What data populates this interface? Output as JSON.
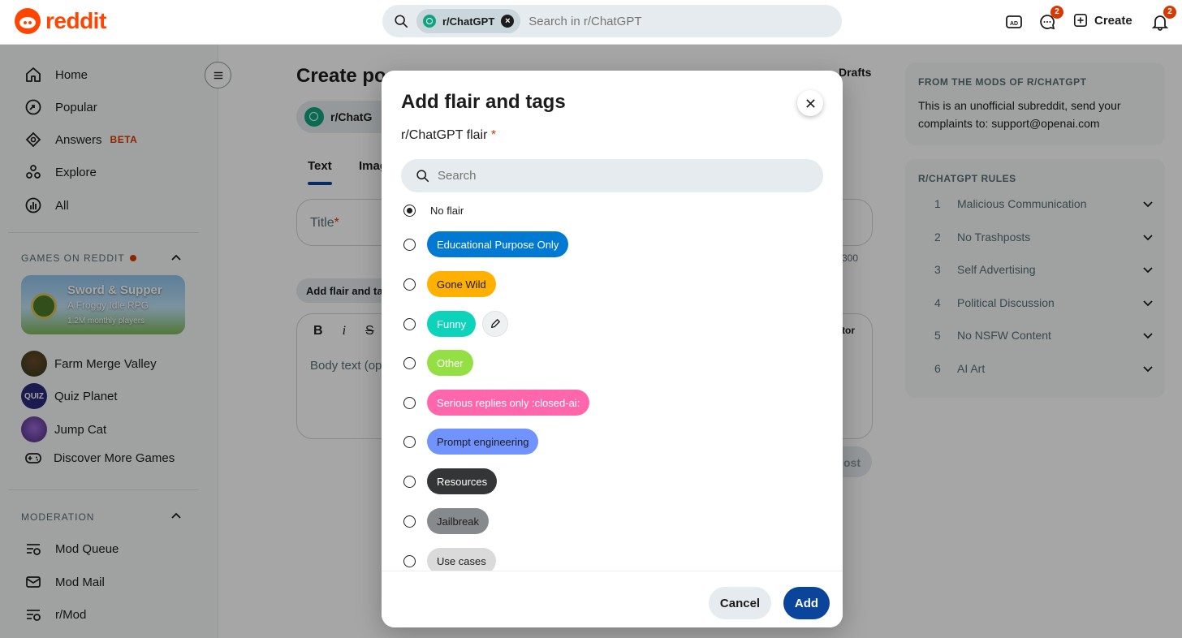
{
  "header": {
    "logo_text": "reddit",
    "search_chip": "r/ChatGPT",
    "search_placeholder": "Search in r/ChatGPT",
    "chat_badge": "2",
    "create_label": "Create",
    "notif_badge": "2"
  },
  "sidebar": {
    "nav": [
      {
        "label": "Home",
        "icon": "home-icon"
      },
      {
        "label": "Popular",
        "icon": "popular-icon"
      },
      {
        "label": "Answers",
        "icon": "answers-icon",
        "badge": "BETA"
      },
      {
        "label": "Explore",
        "icon": "explore-icon"
      },
      {
        "label": "All",
        "icon": "all-icon"
      }
    ],
    "games_section": "GAMES ON REDDIT",
    "featured_game": {
      "title": "Sword & Supper",
      "subtitle": "A Froggy Idle RPG",
      "players": "1.2M monthly players"
    },
    "games": [
      "Farm Merge Valley",
      "Quiz Planet",
      "Jump Cat",
      "Discover More Games"
    ],
    "moderation_section": "MODERATION",
    "mod_items": [
      "Mod Queue",
      "Mod Mail",
      "r/Mod"
    ]
  },
  "main": {
    "title": "Create po",
    "drafts": "Drafts",
    "subreddit": "r/ChatG",
    "tabs": [
      "Text",
      "Imag"
    ],
    "title_placeholder": "Title",
    "char_count": "300",
    "add_flair": "Add flair and ta",
    "body_placeholder": "Body text (op",
    "editor_link": "tor",
    "post_btn": "ost"
  },
  "right": {
    "mods_title": "FROM THE MODS OF R/CHATGPT",
    "mods_text": "This is an unofficial subreddit, send your complaints to: support@openai.com",
    "rules_title": "R/CHATGPT RULES",
    "rules": [
      {
        "num": "1",
        "text": "Malicious Communication"
      },
      {
        "num": "2",
        "text": "No Trashposts"
      },
      {
        "num": "3",
        "text": "Self Advertising"
      },
      {
        "num": "4",
        "text": "Political Discussion"
      },
      {
        "num": "5",
        "text": "No NSFW Content"
      },
      {
        "num": "6",
        "text": "AI Art"
      }
    ]
  },
  "modal": {
    "title": "Add flair and tags",
    "flair_label": "r/ChatGPT flair",
    "required_mark": "*",
    "search_placeholder": "Search",
    "no_flair": "No flair",
    "flairs": [
      {
        "label": "Educational Purpose Only",
        "bg": "#0079d3",
        "fg": "#ffffff"
      },
      {
        "label": "Gone Wild",
        "bg": "#ffb000",
        "fg": "#1c1c1c"
      },
      {
        "label": "Funny",
        "bg": "#0dd3bb",
        "fg": "#ffffff"
      },
      {
        "label": "Other",
        "bg": "#94e044",
        "fg": "#ffffff"
      },
      {
        "label": "Serious replies only :closed-ai:",
        "bg": "#ff66ac",
        "fg": "#ffffff"
      },
      {
        "label": "Prompt engineering",
        "bg": "#7193ff",
        "fg": "#1c1c1c"
      },
      {
        "label": "Resources",
        "bg": "#343536",
        "fg": "#ffffff"
      },
      {
        "label": "Jailbreak",
        "bg": "#878a8c",
        "fg": "#1c1c1c"
      },
      {
        "label": "Use cases",
        "bg": "#dadada",
        "fg": "#1c1c1c"
      }
    ],
    "cancel": "Cancel",
    "add": "Add"
  }
}
